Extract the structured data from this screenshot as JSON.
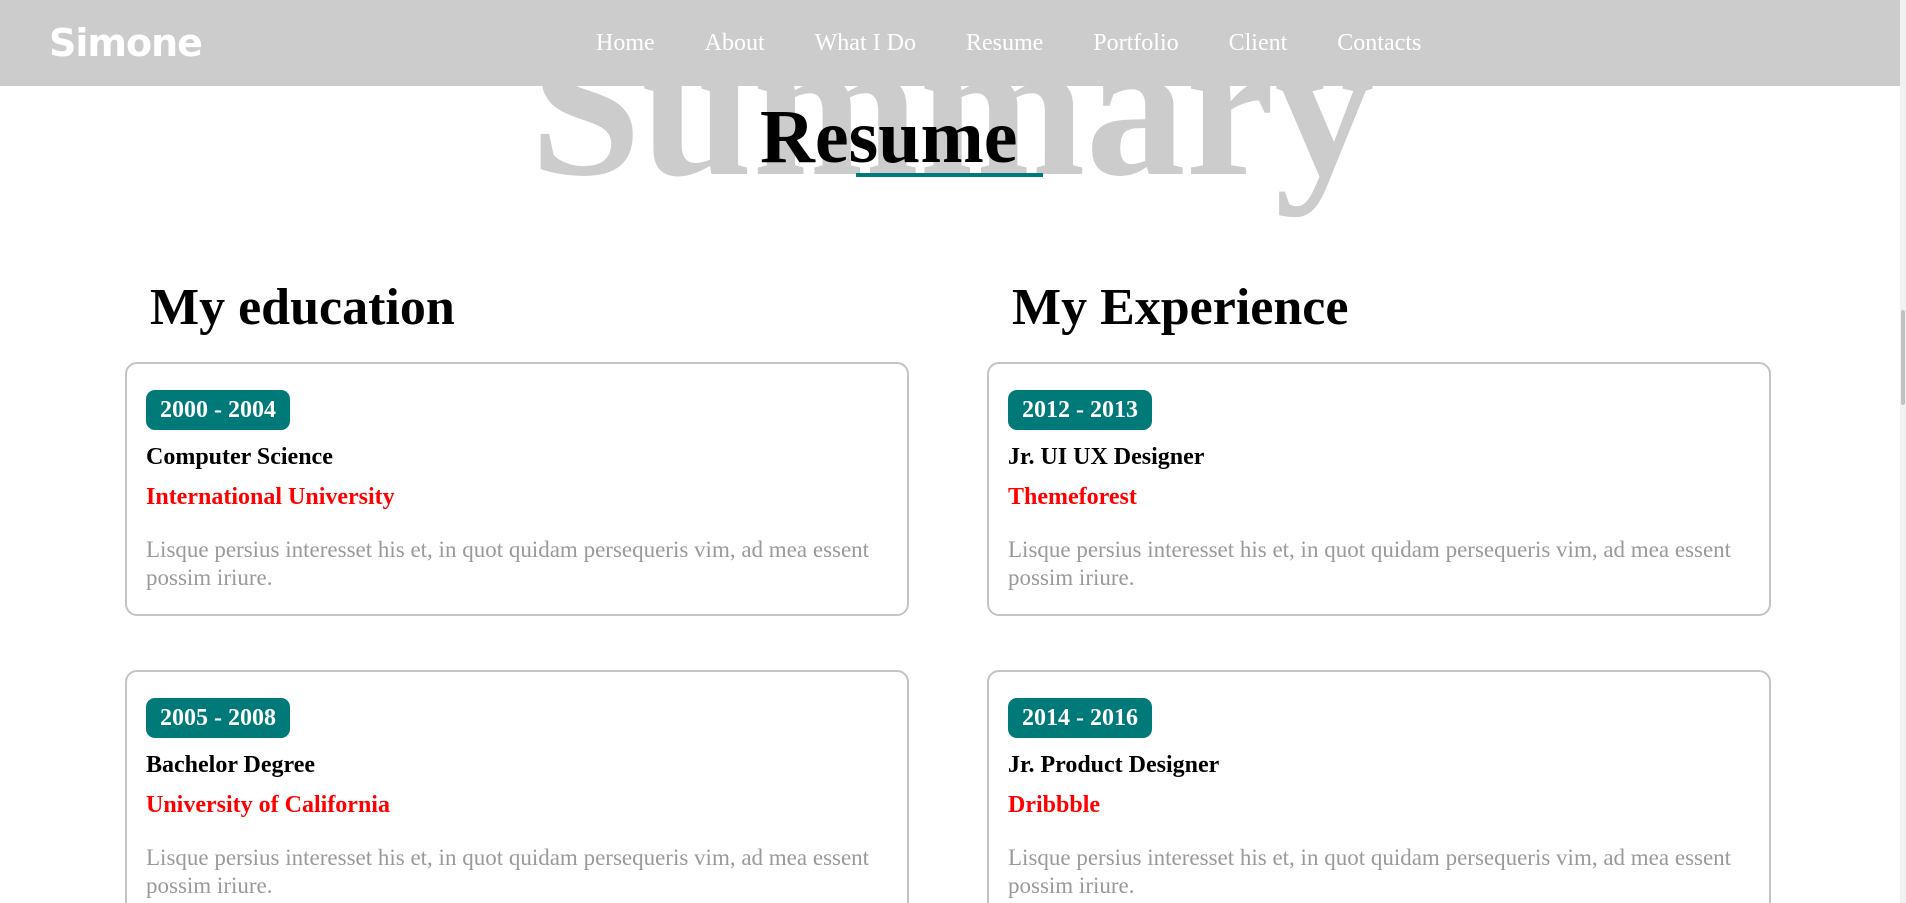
{
  "header": {
    "logo": "Simone",
    "nav": [
      "Home",
      "About",
      "What I Do",
      "Resume",
      "Portfolio",
      "Client",
      "Contacts"
    ]
  },
  "section": {
    "background_title": "Summary",
    "title": "Resume"
  },
  "education": {
    "heading": "My education",
    "items": [
      {
        "years": "2000 - 2004",
        "title": "Computer Science",
        "org": "International University",
        "description": "Lisque persius interesset his et, in quot quidam persequeris vim, ad mea essent possim iriure."
      },
      {
        "years": "2005 - 2008",
        "title": "Bachelor Degree",
        "org": "University of California",
        "description": "Lisque persius interesset his et, in quot quidam persequeris vim, ad mea essent possim iriure."
      }
    ]
  },
  "experience": {
    "heading": "My Experience",
    "items": [
      {
        "years": "2012 - 2013",
        "title": "Jr. UI UX Designer",
        "org": "Themeforest",
        "description": "Lisque persius interesset his et, in quot quidam persequeris vim, ad mea essent possim iriure."
      },
      {
        "years": "2014 - 2016",
        "title": "Jr. Product Designer",
        "org": "Dribbble",
        "description": "Lisque persius interesset his et, in quot quidam persequeris vim, ad mea essent possim iriure."
      }
    ]
  },
  "colors": {
    "header_bg": "#cccccc",
    "accent": "#007a78",
    "org_text": "#ff0000",
    "muted_text": "#9a9a9a"
  }
}
